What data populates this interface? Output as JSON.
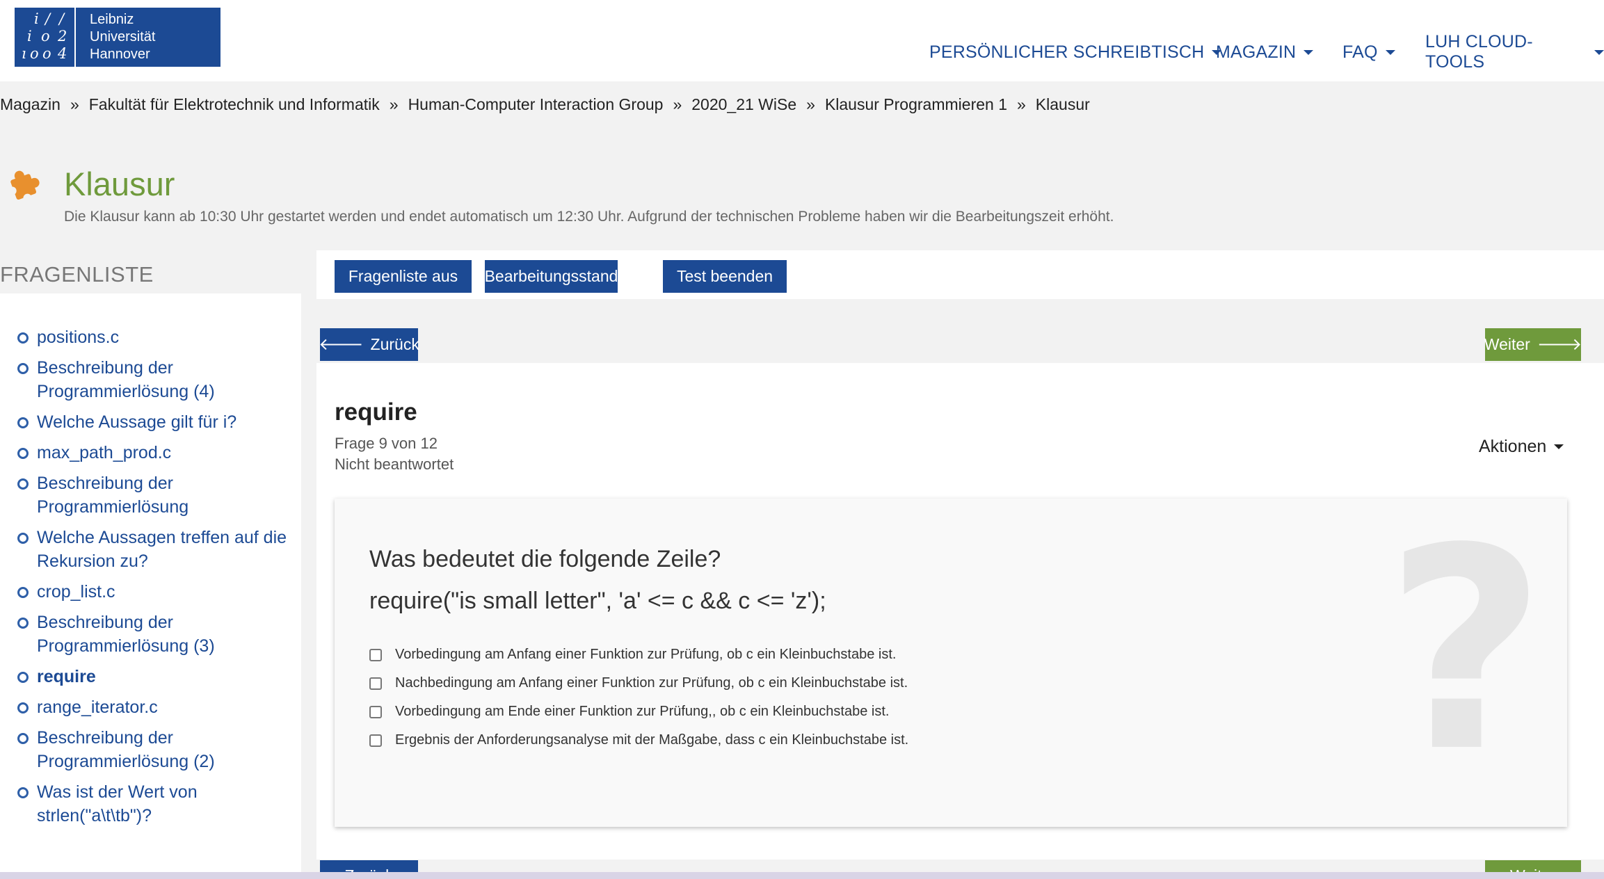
{
  "logo": {
    "line1": "Leibniz",
    "line2": "Universität",
    "line3": "Hannover",
    "accent": "#1c4a94"
  },
  "nav": [
    {
      "label": "PERSÖNLICHER SCHREIBTISCH"
    },
    {
      "label": "MAGAZIN"
    },
    {
      "label": "FAQ"
    },
    {
      "label": "LUH CLOUD-TOOLS"
    }
  ],
  "breadcrumb": [
    "Magazin",
    "Fakultät für Elektrotechnik und Informatik",
    "Human-Computer Interaction Group",
    "2020_21 WiSe",
    "Klausur Programmieren 1",
    "Klausur"
  ],
  "breadcrumb_sep": "»",
  "page": {
    "title": "Klausur",
    "description": "Die Klausur kann ab 10:30 Uhr gestartet werden und endet automatisch um 12:30 Uhr. Aufgrund der technischen Probleme haben wir die Bearbeitungszeit erhöht.",
    "title_color": "#6f9a3c"
  },
  "sidebar": {
    "title": "FRAGENLISTE",
    "items": [
      {
        "label": "positions.c"
      },
      {
        "label": "Beschreibung der Programmierlösung (4)"
      },
      {
        "label": "Welche Aussage gilt für i?"
      },
      {
        "label": "max_path_prod.c"
      },
      {
        "label": "Beschreibung der Programmierlösung"
      },
      {
        "label": "Welche Aussagen treffen auf die Rekursion zu?"
      },
      {
        "label": "crop_list.c"
      },
      {
        "label": "Beschreibung der Programmierlösung (3)"
      },
      {
        "label": "require",
        "active": true
      },
      {
        "label": "range_iterator.c"
      },
      {
        "label": "Beschreibung der Programmierlösung (2)"
      },
      {
        "label": "Was ist der Wert von strlen(\"a\\t\\tb\")?"
      }
    ]
  },
  "toolbar": {
    "list_off": "Fragenliste aus",
    "progress": "Bearbeitungsstand",
    "finish": "Test beenden"
  },
  "pager": {
    "back": "Zurück",
    "next": "Weiter",
    "back_arrow": "🡐",
    "next_arrow": "🡒"
  },
  "question": {
    "name": "require",
    "counter": "Frage 9 von 12",
    "status": "Nicht beantwortet",
    "actions": "Aktionen",
    "text_line1": "Was bedeutet die folgende Zeile?",
    "text_line2": "require(\"is small letter\", 'a' <= c && c <= 'z');",
    "watermark": "?",
    "options": [
      "Vorbedingung am Anfang einer Funktion zur Prüfung, ob c ein Kleinbuchstabe ist.",
      "Nachbedingung am Anfang einer Funktion zur Prüfung, ob c ein Kleinbuchstabe ist.",
      "Vorbedingung am Ende einer Funktion zur Prüfung,, ob c ein Kleinbuchstabe ist.",
      "Ergebnis der Anforderungsanalyse mit der Maßgabe, dass c ein Kleinbuchstabe ist."
    ]
  }
}
